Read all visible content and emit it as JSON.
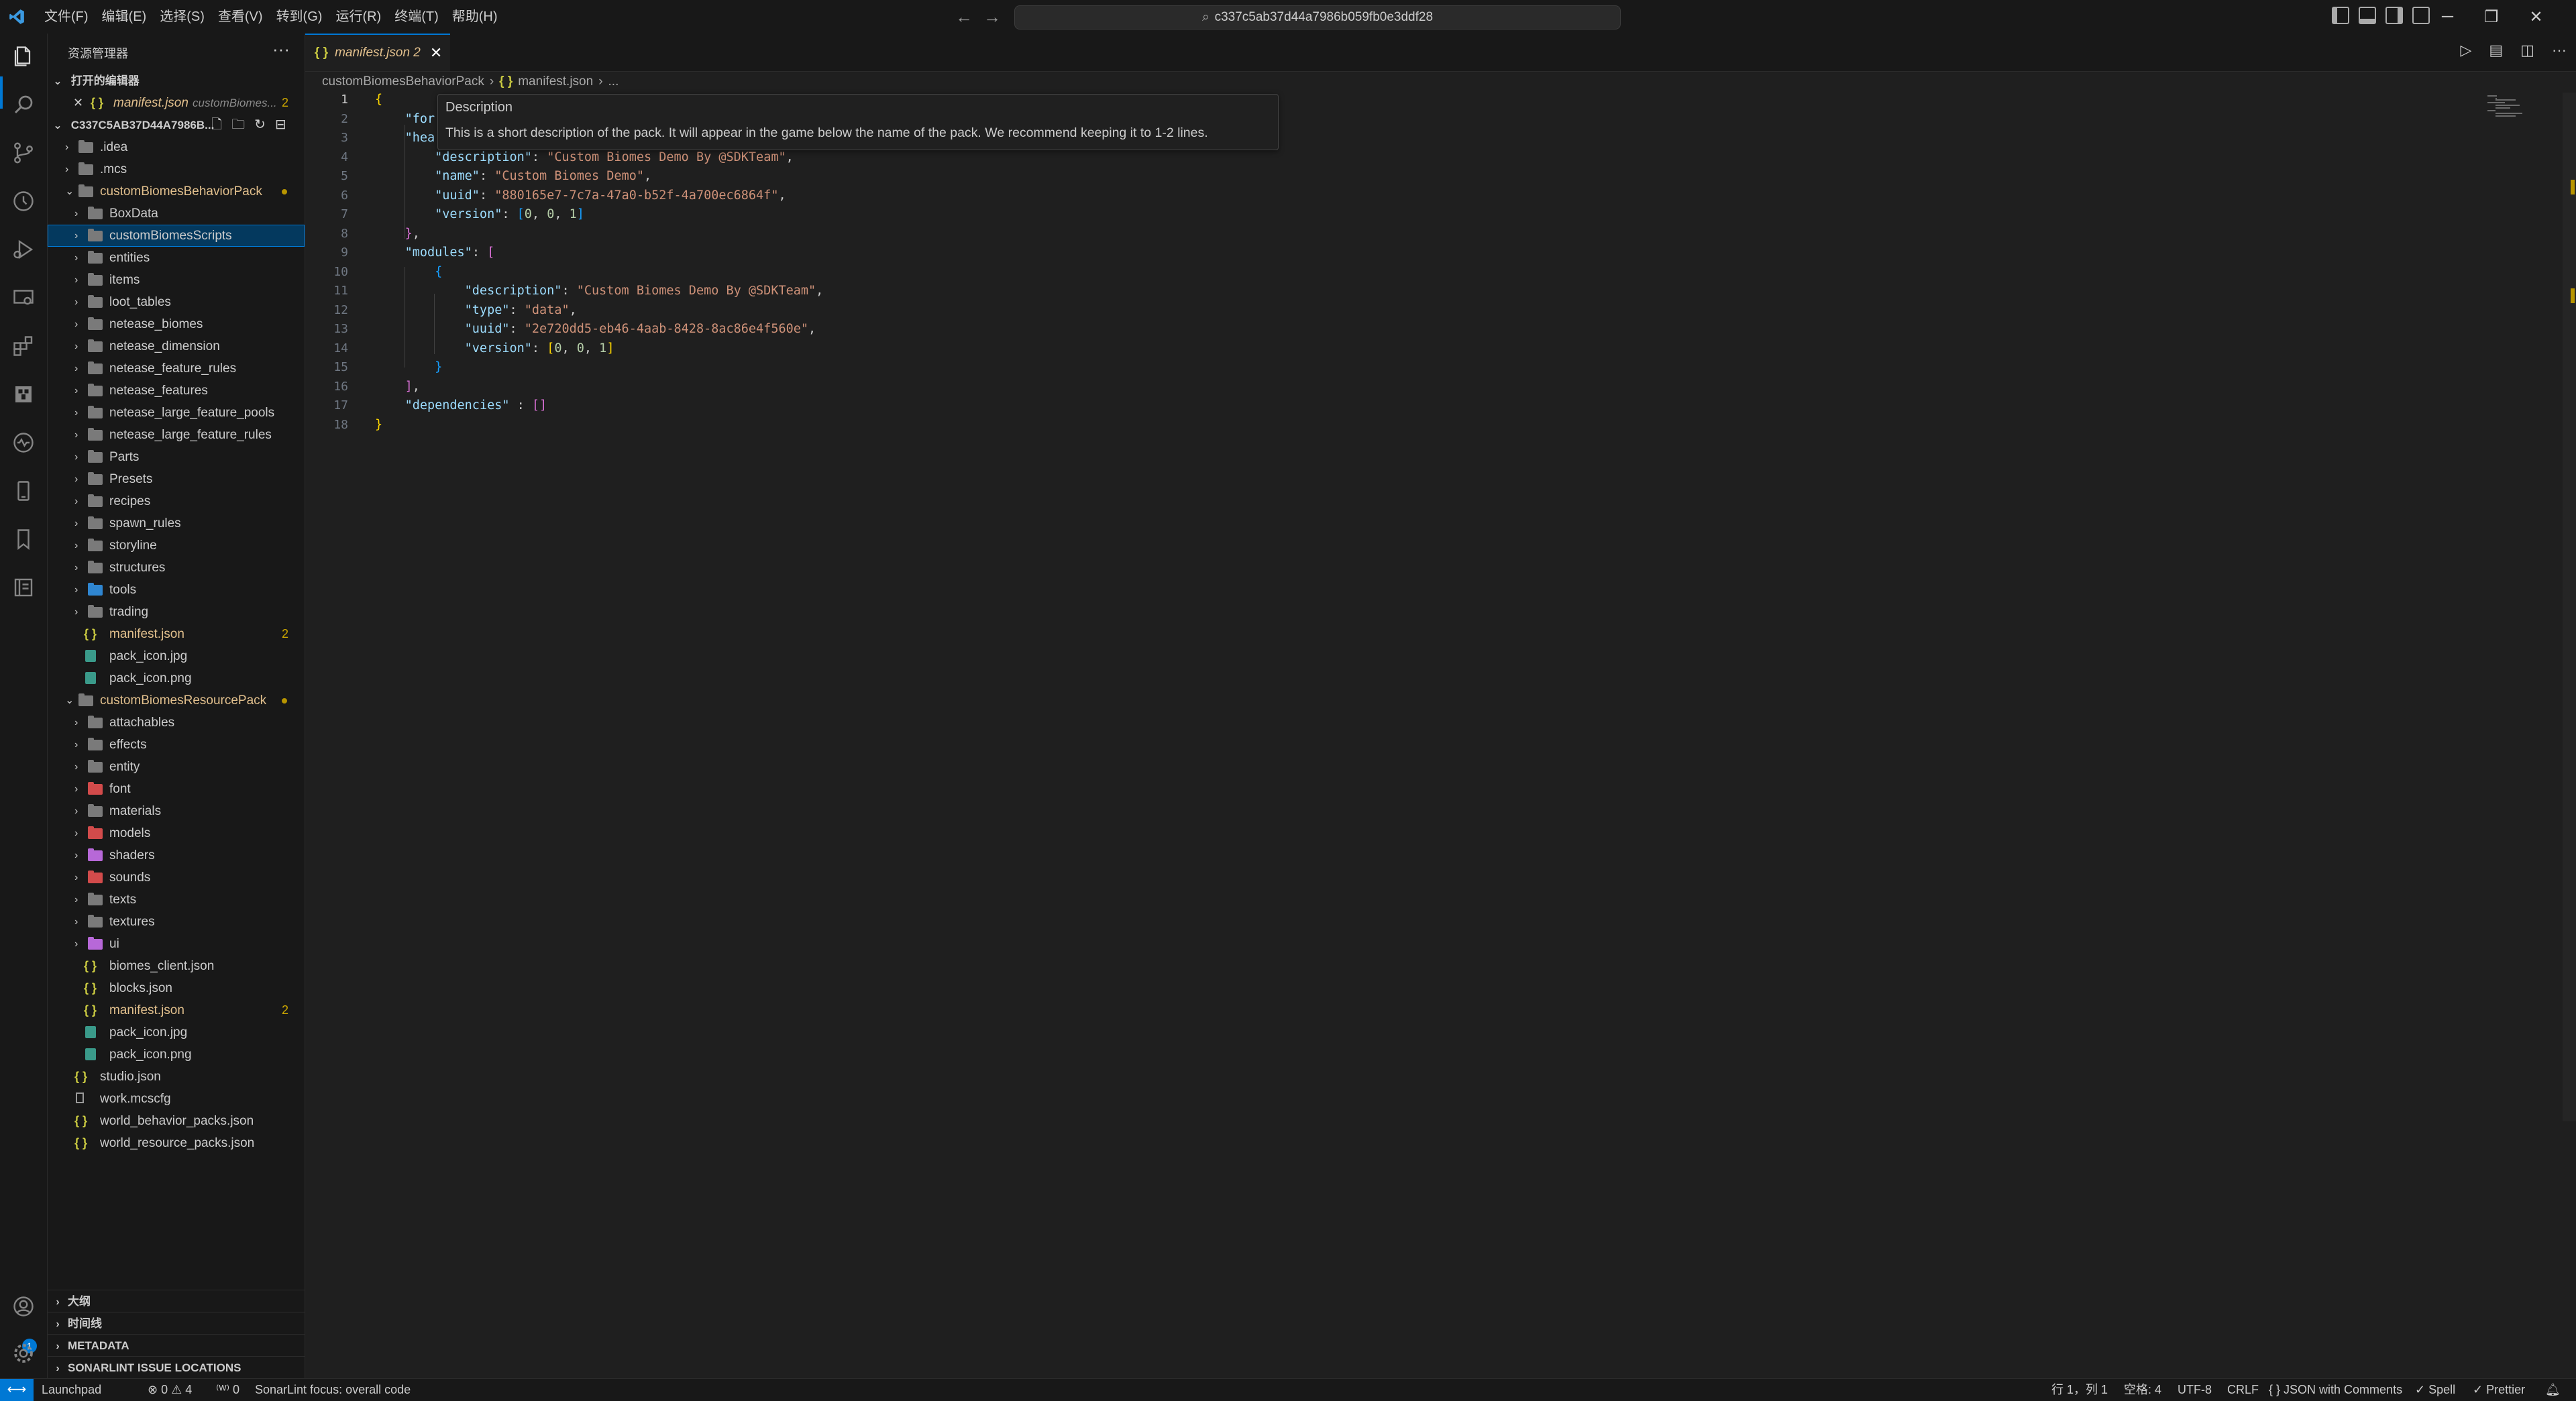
{
  "menu": [
    "文件(F)",
    "编辑(E)",
    "选择(S)",
    "查看(V)",
    "转到(G)",
    "运行(R)",
    "终端(T)",
    "帮助(H)"
  ],
  "command_center": {
    "text": "c337c5ab37d44a7986b059fb0e3ddf28"
  },
  "sidebar": {
    "header": "资源管理器",
    "open_editors_title": "打开的编辑器",
    "open_editor": {
      "name": "manifest.json",
      "folder": "customBiomes...",
      "badge": "2"
    },
    "workspace_title": "C337C5AB37D44A7986B...",
    "tree": [
      {
        "label": ".idea",
        "depth": 1,
        "kind": "folder-special",
        "chevron": "›"
      },
      {
        "label": ".mcs",
        "depth": 1,
        "kind": "folder",
        "chevron": "›"
      },
      {
        "label": "customBiomesBehaviorPack",
        "depth": 1,
        "kind": "folder-open",
        "chevron": "⌄",
        "modified": true,
        "dot": true
      },
      {
        "label": "BoxData",
        "depth": 2,
        "kind": "folder",
        "chevron": "›"
      },
      {
        "label": "customBiomesScripts",
        "depth": 2,
        "kind": "folder",
        "chevron": "›",
        "selected": true
      },
      {
        "label": "entities",
        "depth": 2,
        "kind": "folder",
        "chevron": "›"
      },
      {
        "label": "items",
        "depth": 2,
        "kind": "folder",
        "chevron": "›"
      },
      {
        "label": "loot_tables",
        "depth": 2,
        "kind": "folder",
        "chevron": "›"
      },
      {
        "label": "netease_biomes",
        "depth": 2,
        "kind": "folder",
        "chevron": "›"
      },
      {
        "label": "netease_dimension",
        "depth": 2,
        "kind": "folder",
        "chevron": "›"
      },
      {
        "label": "netease_feature_rules",
        "depth": 2,
        "kind": "folder",
        "chevron": "›"
      },
      {
        "label": "netease_features",
        "depth": 2,
        "kind": "folder",
        "chevron": "›"
      },
      {
        "label": "netease_large_feature_pools",
        "depth": 2,
        "kind": "folder",
        "chevron": "›"
      },
      {
        "label": "netease_large_feature_rules",
        "depth": 2,
        "kind": "folder",
        "chevron": "›"
      },
      {
        "label": "Parts",
        "depth": 2,
        "kind": "folder",
        "chevron": "›"
      },
      {
        "label": "Presets",
        "depth": 2,
        "kind": "folder",
        "chevron": "›"
      },
      {
        "label": "recipes",
        "depth": 2,
        "kind": "folder",
        "chevron": "›"
      },
      {
        "label": "spawn_rules",
        "depth": 2,
        "kind": "folder",
        "chevron": "›"
      },
      {
        "label": "storyline",
        "depth": 2,
        "kind": "folder",
        "chevron": "›"
      },
      {
        "label": "structures",
        "depth": 2,
        "kind": "folder",
        "chevron": "›"
      },
      {
        "label": "tools",
        "depth": 2,
        "kind": "folder-blue",
        "chevron": "›"
      },
      {
        "label": "trading",
        "depth": 2,
        "kind": "folder",
        "chevron": "›"
      },
      {
        "label": "manifest.json",
        "depth": 2,
        "kind": "json",
        "modified": true,
        "badge": "2"
      },
      {
        "label": "pack_icon.jpg",
        "depth": 2,
        "kind": "image"
      },
      {
        "label": "pack_icon.png",
        "depth": 2,
        "kind": "image"
      },
      {
        "label": "customBiomesResourcePack",
        "depth": 1,
        "kind": "folder-open",
        "chevron": "⌄",
        "modified": true,
        "dot": true
      },
      {
        "label": "attachables",
        "depth": 2,
        "kind": "folder",
        "chevron": "›"
      },
      {
        "label": "effects",
        "depth": 2,
        "kind": "folder",
        "chevron": "›"
      },
      {
        "label": "entity",
        "depth": 2,
        "kind": "folder",
        "chevron": "›"
      },
      {
        "label": "font",
        "depth": 2,
        "kind": "folder-red",
        "chevron": "›"
      },
      {
        "label": "materials",
        "depth": 2,
        "kind": "folder",
        "chevron": "›"
      },
      {
        "label": "models",
        "depth": 2,
        "kind": "folder-red",
        "chevron": "›"
      },
      {
        "label": "shaders",
        "depth": 2,
        "kind": "folder-purple",
        "chevron": "›"
      },
      {
        "label": "sounds",
        "depth": 2,
        "kind": "folder-red",
        "chevron": "›"
      },
      {
        "label": "texts",
        "depth": 2,
        "kind": "folder",
        "chevron": "›"
      },
      {
        "label": "textures",
        "depth": 2,
        "kind": "folder",
        "chevron": "›"
      },
      {
        "label": "ui",
        "depth": 2,
        "kind": "folder-purple",
        "chevron": "›"
      },
      {
        "label": "biomes_client.json",
        "depth": 2,
        "kind": "json"
      },
      {
        "label": "blocks.json",
        "depth": 2,
        "kind": "json"
      },
      {
        "label": "manifest.json",
        "depth": 2,
        "kind": "json",
        "modified": true,
        "badge": "2"
      },
      {
        "label": "pack_icon.jpg",
        "depth": 2,
        "kind": "image"
      },
      {
        "label": "pack_icon.png",
        "depth": 2,
        "kind": "image"
      },
      {
        "label": "studio.json",
        "depth": 1,
        "kind": "json"
      },
      {
        "label": "work.mcscfg",
        "depth": 1,
        "kind": "file"
      },
      {
        "label": "world_behavior_packs.json",
        "depth": 1,
        "kind": "json"
      },
      {
        "label": "world_resource_packs.json",
        "depth": 1,
        "kind": "json"
      }
    ],
    "bottom_sections": [
      "大纲",
      "时间线",
      "METADATA",
      "SONARLINT ISSUE LOCATIONS"
    ]
  },
  "tab": {
    "label": "manifest.json 2"
  },
  "breadcrumb": [
    "customBiomesBehaviorPack",
    "manifest.json",
    "..."
  ],
  "editor": {
    "lines": [
      [
        [
          "b1",
          "{"
        ]
      ],
      [
        [
          "p",
          "    "
        ],
        [
          "k",
          "\"for"
        ]
      ],
      [
        [
          "p",
          "    "
        ],
        [
          "k",
          "\"hea"
        ]
      ],
      [
        [
          "p",
          "        "
        ],
        [
          "k",
          "\"description\""
        ],
        [
          "p",
          ": "
        ],
        [
          "s",
          "\"Custom Biomes Demo By @SDKTeam\""
        ],
        [
          "p",
          ","
        ]
      ],
      [
        [
          "p",
          "        "
        ],
        [
          "k",
          "\"name\""
        ],
        [
          "p",
          ": "
        ],
        [
          "s",
          "\"Custom Biomes Demo\""
        ],
        [
          "p",
          ","
        ]
      ],
      [
        [
          "p",
          "        "
        ],
        [
          "k",
          "\"uuid\""
        ],
        [
          "p",
          ": "
        ],
        [
          "s",
          "\"880165e7-7c7a-47a0-b52f-4a700ec6864f\""
        ],
        [
          "p",
          ","
        ]
      ],
      [
        [
          "p",
          "        "
        ],
        [
          "k",
          "\"version\""
        ],
        [
          "p",
          ": "
        ],
        [
          "b3",
          "["
        ],
        [
          "n",
          "0"
        ],
        [
          "p",
          ", "
        ],
        [
          "n",
          "0"
        ],
        [
          "p",
          ", "
        ],
        [
          "n",
          "1"
        ],
        [
          "b3",
          "]"
        ]
      ],
      [
        [
          "p",
          "    "
        ],
        [
          "b2",
          "}"
        ],
        [
          "p",
          ","
        ]
      ],
      [
        [
          "p",
          "    "
        ],
        [
          "k",
          "\"modules\""
        ],
        [
          "p",
          ": "
        ],
        [
          "b2",
          "["
        ]
      ],
      [
        [
          "p",
          "        "
        ],
        [
          "b3",
          "{"
        ]
      ],
      [
        [
          "p",
          "            "
        ],
        [
          "k",
          "\"description\""
        ],
        [
          "p",
          ": "
        ],
        [
          "s",
          "\"Custom Biomes Demo By @SDKTeam\""
        ],
        [
          "p",
          ","
        ]
      ],
      [
        [
          "p",
          "            "
        ],
        [
          "k",
          "\"type\""
        ],
        [
          "p",
          ": "
        ],
        [
          "s",
          "\"data\""
        ],
        [
          "p",
          ","
        ]
      ],
      [
        [
          "p",
          "            "
        ],
        [
          "k",
          "\"uuid\""
        ],
        [
          "p",
          ": "
        ],
        [
          "s",
          "\"2e720dd5-eb46-4aab-8428-8ac86e4f560e\""
        ],
        [
          "p",
          ","
        ]
      ],
      [
        [
          "p",
          "            "
        ],
        [
          "k",
          "\"version\""
        ],
        [
          "p",
          ": "
        ],
        [
          "b1",
          "["
        ],
        [
          "n",
          "0"
        ],
        [
          "p",
          ", "
        ],
        [
          "n",
          "0"
        ],
        [
          "p",
          ", "
        ],
        [
          "n",
          "1"
        ],
        [
          "b1",
          "]"
        ]
      ],
      [
        [
          "p",
          "        "
        ],
        [
          "b3",
          "}"
        ]
      ],
      [
        [
          "p",
          "    "
        ],
        [
          "b2",
          "]"
        ],
        [
          "p",
          ","
        ]
      ],
      [
        [
          "p",
          "    "
        ],
        [
          "k",
          "\"dependencies\""
        ],
        [
          "p",
          " : "
        ],
        [
          "b2",
          "[]"
        ]
      ],
      [
        [
          "b1",
          "}"
        ]
      ]
    ],
    "hover": {
      "title": "Description",
      "text": "This is a short description of the pack. It will appear in the game below the name of the pack. We recommend keeping it to 1-2 lines."
    }
  },
  "statusbar": {
    "left": [
      "Launchpad",
      "⊗ 0 ⚠ 4",
      "⁽ᵂ⁾ 0",
      "SonarLint focus: overall code"
    ],
    "right": [
      "行 1，列 1",
      "空格: 4",
      "UTF-8",
      "CRLF",
      "{ } JSON with Comments",
      "✓ Spell",
      "✓ Prettier"
    ]
  },
  "colors": {
    "accent": "#0078d4",
    "modified": "#e2c08d",
    "json_icon": "#cbcb41"
  }
}
